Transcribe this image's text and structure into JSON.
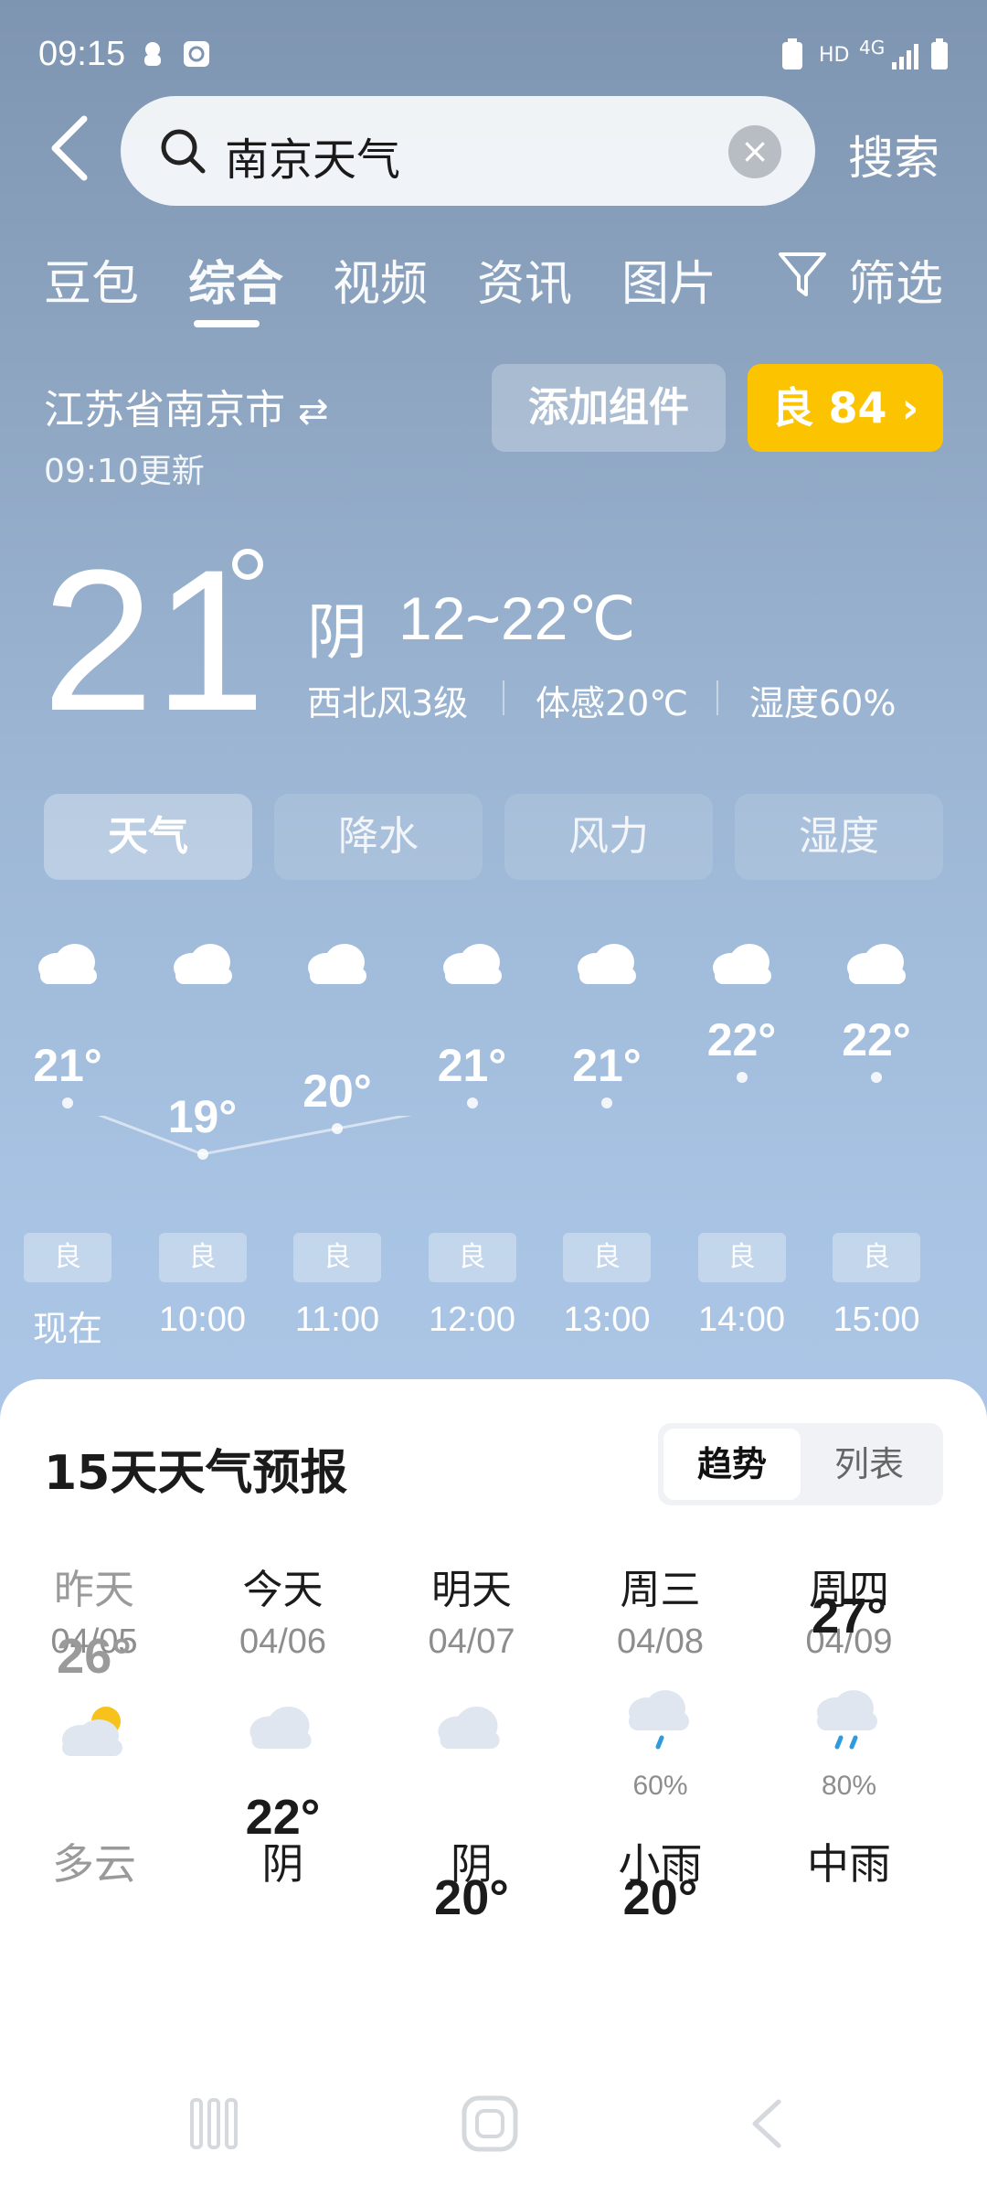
{
  "status_bar": {
    "time": "09:15",
    "network": "HD",
    "network_type": "4G"
  },
  "search": {
    "query": "南京天气",
    "submit_label": "搜索"
  },
  "tabs": [
    {
      "label": "豆包"
    },
    {
      "label": "综合",
      "active": true
    },
    {
      "label": "视频"
    },
    {
      "label": "资讯"
    },
    {
      "label": "图片"
    },
    {
      "label": "筛选"
    }
  ],
  "location": {
    "city": "江苏省南京市",
    "updated": "09:10更新"
  },
  "actions": {
    "add_widget": "添加组件",
    "aqi": "良 84"
  },
  "current": {
    "temp": "21",
    "condition": "阴",
    "range": "12~22℃",
    "wind": "西北风3级",
    "feels_like": "体感20℃",
    "humidity": "湿度60%"
  },
  "segments": [
    {
      "label": "天气",
      "active": true
    },
    {
      "label": "降水"
    },
    {
      "label": "风力"
    },
    {
      "label": "湿度"
    }
  ],
  "hourly": [
    {
      "time": "现在",
      "temp": "21°",
      "value": 21,
      "aqi": "良"
    },
    {
      "time": "10:00",
      "temp": "19°",
      "value": 19,
      "aqi": "良"
    },
    {
      "time": "11:00",
      "temp": "20°",
      "value": 20,
      "aqi": "良"
    },
    {
      "time": "12:00",
      "temp": "21°",
      "value": 21,
      "aqi": "良"
    },
    {
      "time": "13:00",
      "temp": "21°",
      "value": 21,
      "aqi": "良"
    },
    {
      "time": "14:00",
      "temp": "22°",
      "value": 22,
      "aqi": "良"
    },
    {
      "time": "15:00",
      "temp": "22°",
      "value": 22,
      "aqi": "良"
    }
  ],
  "forecast": {
    "title": "15天天气预报",
    "view_toggle": [
      "趋势",
      "列表"
    ],
    "days": [
      {
        "name": "昨天",
        "date": "04/05",
        "icon": "partly-cloudy-icon",
        "prob": "",
        "condition": "多云",
        "high": "26°",
        "high_value": 26,
        "past": true
      },
      {
        "name": "今天",
        "date": "04/06",
        "icon": "cloud-icon",
        "prob": "",
        "condition": "阴",
        "high": "22°",
        "high_value": 22
      },
      {
        "name": "明天",
        "date": "04/07",
        "icon": "cloud-icon",
        "prob": "",
        "condition": "阴",
        "high": "20°",
        "high_value": 20
      },
      {
        "name": "周三",
        "date": "04/08",
        "icon": "light-rain-icon",
        "prob": "60%",
        "condition": "小雨",
        "high": "20°",
        "high_value": 20
      },
      {
        "name": "周四",
        "date": "04/09",
        "icon": "moderate-rain-icon",
        "prob": "80%",
        "condition": "中雨",
        "high": "27°",
        "high_value": 27
      }
    ]
  },
  "colors": {
    "aqi_good": "#fcc300",
    "sky_top": "#7e95b2",
    "sky_bottom": "#b5cfee"
  }
}
